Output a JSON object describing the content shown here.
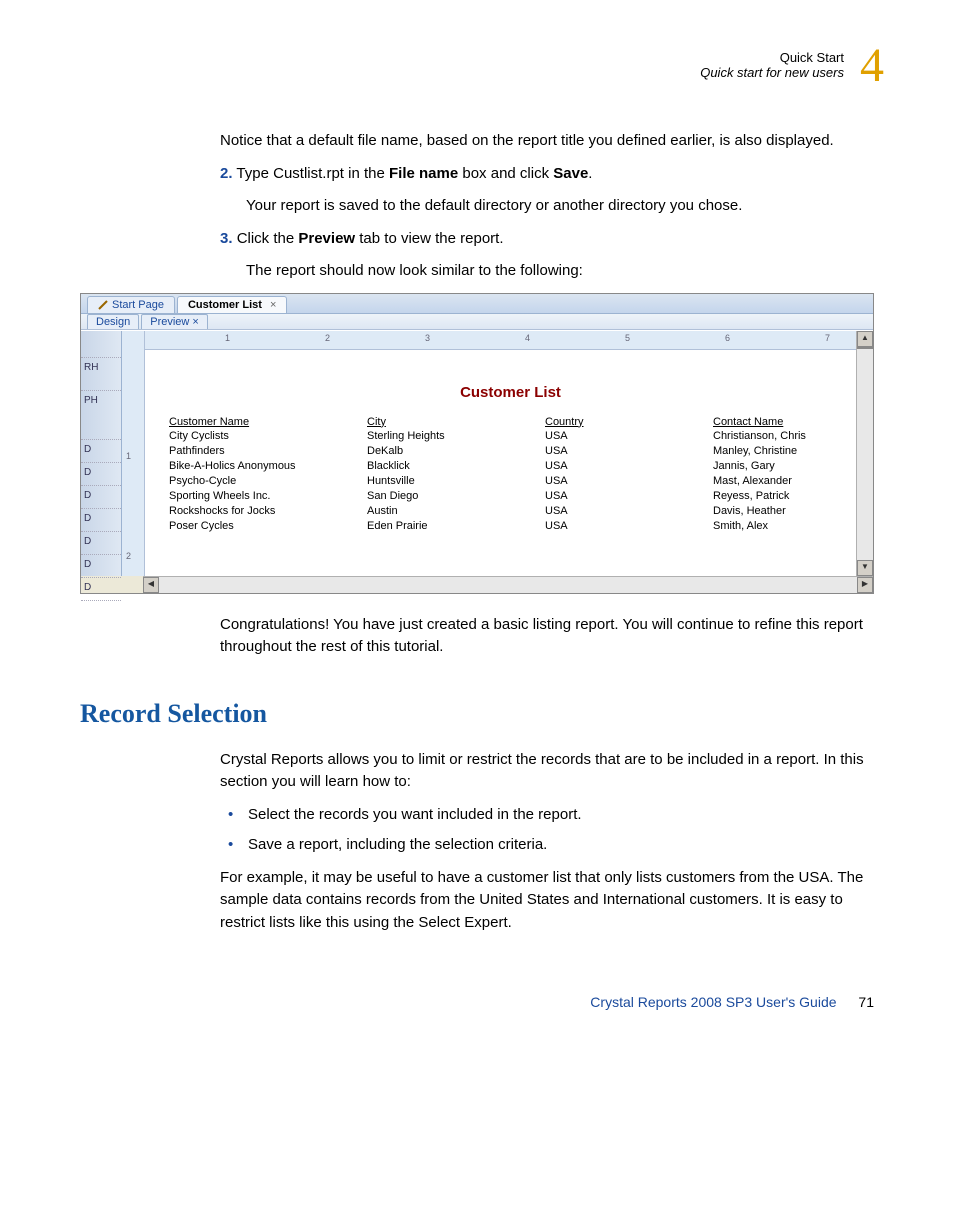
{
  "header": {
    "line1": "Quick Start",
    "line2": "Quick start for new users",
    "chapter_number": "4"
  },
  "body": {
    "p_notice": "Notice that a default file name, based on the report title you defined earlier, is also displayed.",
    "step2_num": "2.",
    "step2_a": "Type Custlist.rpt in the ",
    "step2_b": "File name",
    "step2_c": " box and click ",
    "step2_d": "Save",
    "step2_e": ".",
    "step2_sub": "Your report is saved to the default directory or another directory you chose.",
    "step3_num": "3.",
    "step3_a": "Click the ",
    "step3_b": "Preview",
    "step3_c": " tab to view the report.",
    "p_similar": "The report should now look similar to the following:",
    "p_congrats": "Congratulations! You have just created a basic listing report. You will continue to refine this report throughout the rest of this tutorial.",
    "h_record": "Record Selection",
    "p_crystal": "Crystal Reports allows you to limit or restrict the records that are to be included in a report. In this section you will learn how to:",
    "bullet1": "Select the records you want included in the report.",
    "bullet2": "Save a report, including the selection criteria.",
    "p_example": "For example, it may be useful to have a customer list that only lists customers from the USA. The sample data contains records from the United States and International customers. It is easy to restrict lists like this using the Select Expert."
  },
  "screenshot": {
    "tabs": {
      "start": "Start Page",
      "custlist": "Customer List",
      "close_x": "×"
    },
    "subtabs": {
      "design": "Design",
      "preview": "Preview",
      "close_x": "×"
    },
    "sections": {
      "rh": "RH",
      "ph": "PH",
      "d": "D"
    },
    "ruler_numbers": [
      "1",
      "2",
      "3",
      "4",
      "5",
      "6",
      "7"
    ],
    "vruler_numbers": [
      "1",
      "2"
    ],
    "report_title": "Customer List",
    "columns": [
      "Customer Name",
      "City",
      "Country",
      "Contact Name"
    ],
    "rows": [
      [
        "City Cyclists",
        "Sterling Heights",
        "USA",
        "Christianson, Chris"
      ],
      [
        "Pathfinders",
        "DeKalb",
        "USA",
        "Manley, Christine"
      ],
      [
        "Bike-A-Holics Anonymous",
        "Blacklick",
        "USA",
        "Jannis, Gary"
      ],
      [
        "Psycho-Cycle",
        "Huntsville",
        "USA",
        "Mast, Alexander"
      ],
      [
        "Sporting Wheels Inc.",
        "San Diego",
        "USA",
        "Reyess, Patrick"
      ],
      [
        "Rockshocks for Jocks",
        "Austin",
        "USA",
        "Davis, Heather"
      ],
      [
        "Poser Cycles",
        "Eden Prairie",
        "USA",
        "Smith, Alex"
      ]
    ]
  },
  "footer": {
    "guide": "Crystal Reports 2008 SP3 User's Guide",
    "page": "71"
  }
}
